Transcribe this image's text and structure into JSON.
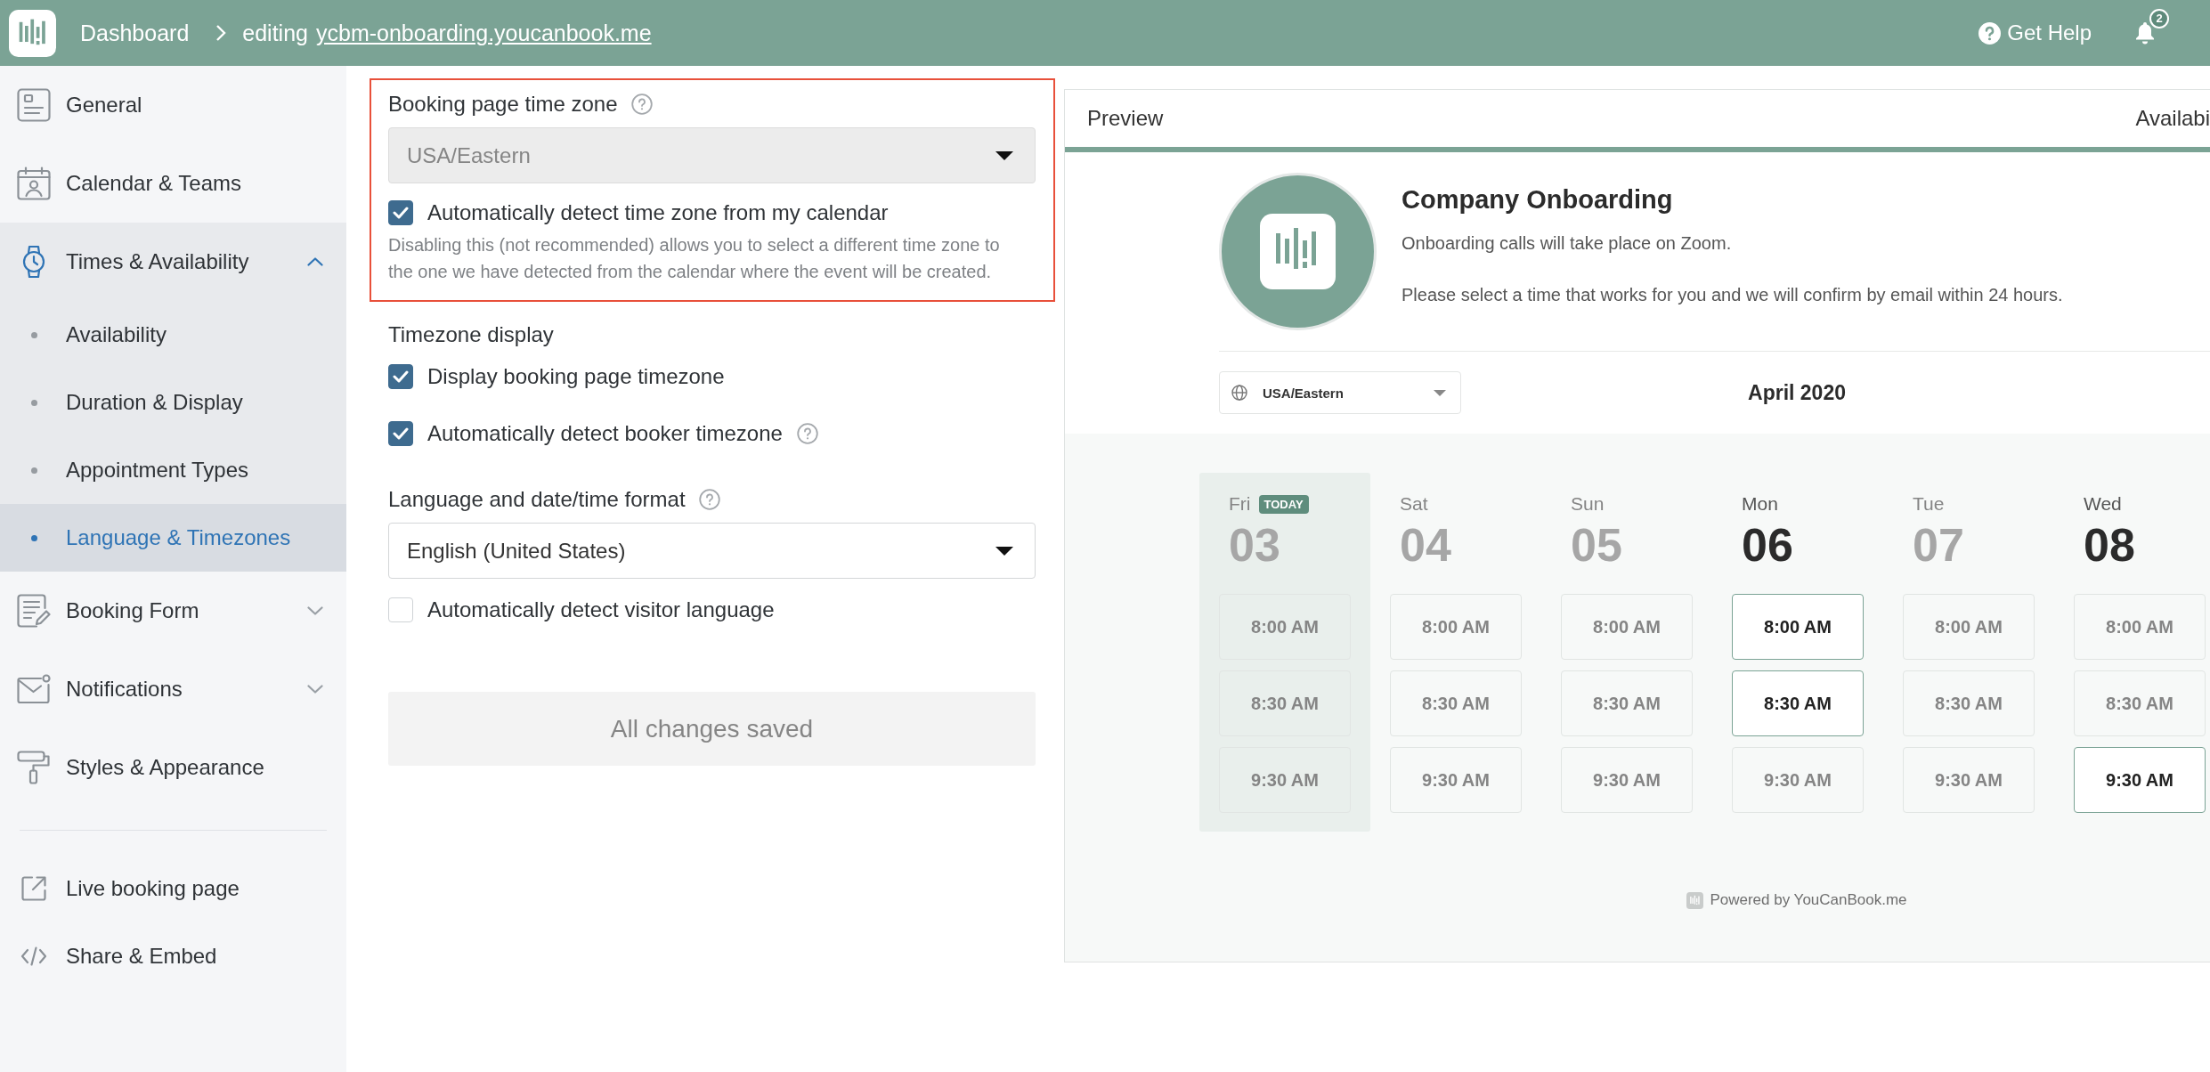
{
  "top_bar": {
    "dashboard": "Dashboard",
    "editing_label": "editing",
    "page_link": "ycbm-onboarding.youcanbook.me",
    "help": "Get Help",
    "notification_count": "2"
  },
  "sidebar": {
    "items": [
      {
        "kind": "page",
        "label": "General",
        "selected": false
      },
      {
        "kind": "page",
        "label": "Calendar & Teams",
        "selected": false
      },
      {
        "kind": "group",
        "label": "Times & Availability",
        "selected": true,
        "expanded": true,
        "children": [
          {
            "label": "Availability",
            "selected": false
          },
          {
            "label": "Duration & Display",
            "selected": false
          },
          {
            "label": "Appointment Types",
            "selected": false
          },
          {
            "label": "Language & Timezones",
            "selected": true
          }
        ]
      },
      {
        "kind": "group",
        "label": "Booking Form",
        "selected": false,
        "expanded": false
      },
      {
        "kind": "group",
        "label": "Notifications",
        "selected": false,
        "expanded": false
      },
      {
        "kind": "page",
        "label": "Styles & Appearance",
        "selected": false
      }
    ],
    "links": [
      {
        "label": "Live booking page"
      },
      {
        "label": "Share & Embed"
      }
    ]
  },
  "timezone_setting": {
    "highlighted": true,
    "label": "Booking page time zone",
    "help": true,
    "select": {
      "value": "USA/Eastern",
      "disabled": true
    },
    "auto_detect": {
      "label": "Automatically detect time zone from my calendar",
      "checked": true
    },
    "hint": "Disabling this (not recommended) allows you to select a different time zone to the one we have detected from the calendar where the event will be created."
  },
  "timezone_display": {
    "label": "Timezone display",
    "options": [
      {
        "label": "Display booking page timezone",
        "checked": true,
        "help": false
      },
      {
        "label": "Automatically detect booker timezone",
        "checked": true,
        "help": true
      }
    ]
  },
  "language_setting": {
    "label": "Language and date/time format",
    "help": true,
    "select": {
      "value": "English (United States)",
      "disabled": false
    },
    "auto_detect": {
      "label": "Automatically detect visitor language",
      "checked": false
    }
  },
  "save_button": {
    "label": "All changes saved",
    "disabled": true
  },
  "preview": {
    "title": "Preview",
    "tab": "Availabi",
    "page": {
      "name": "Company Onboarding",
      "lines": [
        "Onboarding calls will take place on Zoom.",
        "Please select a time that works for you and we will confirm by email within 24 hours."
      ],
      "timezone": "USA/Eastern",
      "month": "April 2020",
      "days": [
        {
          "weekday": "Fri",
          "date": "03",
          "today": true,
          "badge": "TODAY",
          "available": false,
          "slots": [
            {
              "time": "8:00 AM",
              "available": false
            },
            {
              "time": "8:30 AM",
              "available": false
            },
            {
              "time": "9:30 AM",
              "available": false
            }
          ]
        },
        {
          "weekday": "Sat",
          "date": "04",
          "today": false,
          "available": false,
          "slots": [
            {
              "time": "8:00 AM",
              "available": false
            },
            {
              "time": "8:30 AM",
              "available": false
            },
            {
              "time": "9:30 AM",
              "available": false
            }
          ]
        },
        {
          "weekday": "Sun",
          "date": "05",
          "today": false,
          "available": false,
          "slots": [
            {
              "time": "8:00 AM",
              "available": false
            },
            {
              "time": "8:30 AM",
              "available": false
            },
            {
              "time": "9:30 AM",
              "available": false
            }
          ]
        },
        {
          "weekday": "Mon",
          "date": "06",
          "today": false,
          "available": true,
          "slots": [
            {
              "time": "8:00 AM",
              "available": true
            },
            {
              "time": "8:30 AM",
              "available": true
            },
            {
              "time": "9:30 AM",
              "available": false
            }
          ]
        },
        {
          "weekday": "Tue",
          "date": "07",
          "today": false,
          "available": false,
          "slots": [
            {
              "time": "8:00 AM",
              "available": false
            },
            {
              "time": "8:30 AM",
              "available": false
            },
            {
              "time": "9:30 AM",
              "available": false
            }
          ]
        },
        {
          "weekday": "Wed",
          "date": "08",
          "today": false,
          "available": true,
          "slots": [
            {
              "time": "8:00 AM",
              "available": false
            },
            {
              "time": "8:30 AM",
              "available": false
            },
            {
              "time": "9:30 AM",
              "available": true
            }
          ]
        }
      ],
      "footer": "Powered by YouCanBook.me"
    }
  }
}
